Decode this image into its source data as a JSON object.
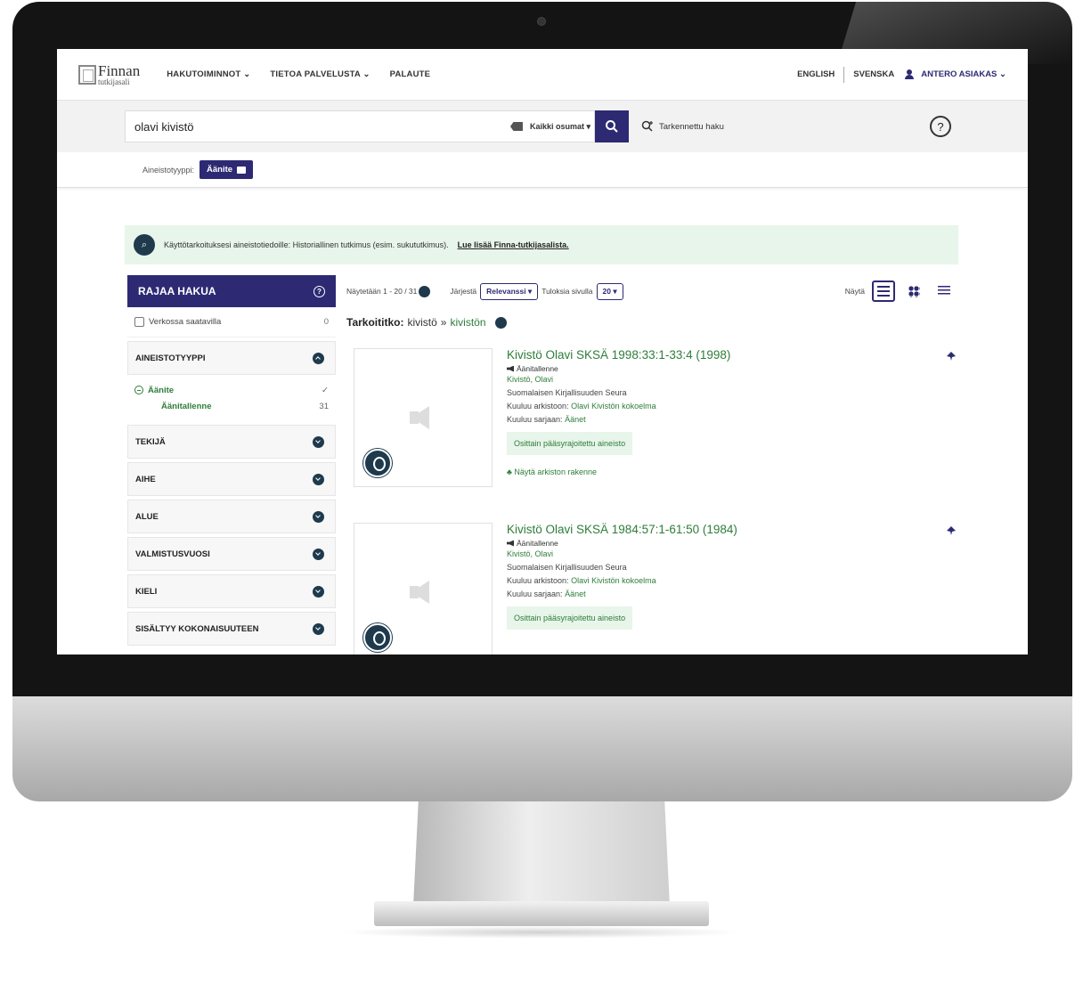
{
  "brand": {
    "main": "Finnan",
    "sub": "tutkijasali"
  },
  "nav": {
    "items": [
      "HAKUTOIMINNOT ⌄",
      "TIETOA PALVELUSTA ⌄",
      "PALAUTE"
    ],
    "english": "ENGLISH",
    "svenska": "SVENSKA",
    "user": "ANTERO ASIAKAS ⌄"
  },
  "search": {
    "value": "olavi kivistö",
    "scope": "Kaikki osumat ▾",
    "advanced": "Tarkennettu haku",
    "help": "?"
  },
  "filter": {
    "label": "Aineistotyyppi:",
    "chip": "Äänite"
  },
  "info": {
    "text": "Käyttötarkoituksesi aineistotiedoille: Historiallinen tutkimus (esim. sukututkimus).",
    "link": "Lue lisää Finna-tutkijasalista."
  },
  "sidebar": {
    "title": "RAJAA HAKUA",
    "online": {
      "label": "Verkossa saatavilla",
      "count": "0"
    },
    "facets": [
      "AINEISTOTYYPPI",
      "TEKIJÄ",
      "AIHE",
      "ALUE",
      "VALMISTUSVUOSI",
      "KIELI",
      "SISÄLTYY KOKONAISUUTEEN"
    ],
    "type_value": "Äänite",
    "type_sub": "Äänitallenne",
    "type_sub_count": "31"
  },
  "toolbar": {
    "showing": "Näytetään 1 - 20 / 31",
    "sort_label": "Järjestä",
    "sort_value": "Relevanssi ▾",
    "per_page_label": "Tuloksia sivulla",
    "per_page_value": "20 ▾",
    "view_label": "Näytä"
  },
  "didyoumean": {
    "label": "Tarkoititko:",
    "term": "kivistö",
    "arrow": "»",
    "suggestion": "kivistön"
  },
  "results": [
    {
      "title": "Kivistö Olavi SKSÄ 1998:33:1-33:4 (1998)",
      "type": "Äänitallenne",
      "author": "Kivistö, Olavi",
      "org": "Suomalaisen Kirjallisuuden Seura",
      "archive_label": "Kuuluu arkistoon:",
      "archive": "Olavi Kivistön kokoelma",
      "series_label": "Kuuluu sarjaan:",
      "series": "Äänet",
      "access": "Osittain pääsyrajoitettu aineisto",
      "structure": "Näytä arkiston rakenne"
    },
    {
      "title": "Kivistö Olavi SKSÄ 1984:57:1-61:50 (1984)",
      "type": "Äänitallenne",
      "author": "Kivistö, Olavi",
      "org": "Suomalaisen Kirjallisuuden Seura",
      "archive_label": "Kuuluu arkistoon:",
      "archive": "Olavi Kivistön kokoelma",
      "series_label": "Kuuluu sarjaan:",
      "series": "Äänet",
      "access": "Osittain pääsyrajoitettu aineisto"
    }
  ]
}
